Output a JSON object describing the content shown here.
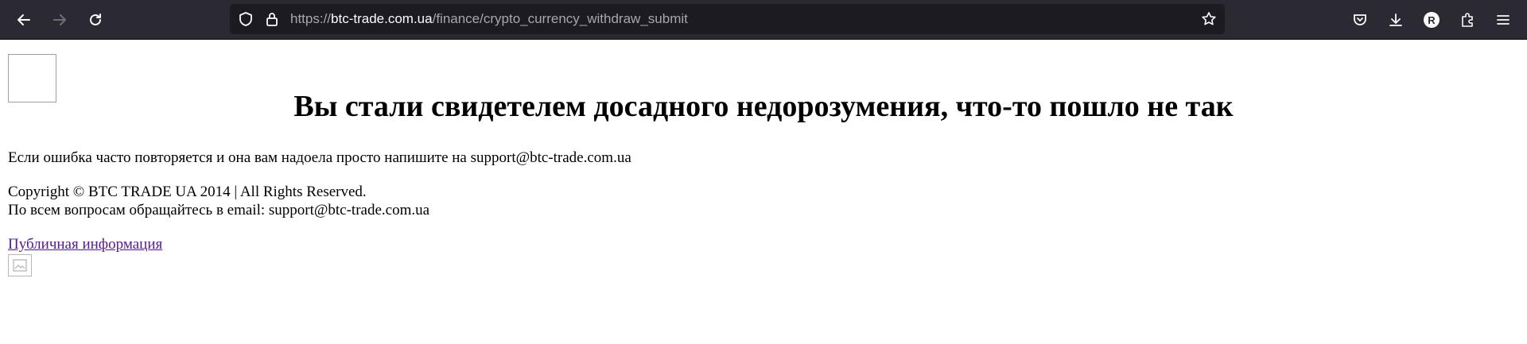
{
  "browser": {
    "url_host_prefix": "https://",
    "url_host": "btc-trade.com.ua",
    "url_path": "/finance/crypto_currency_withdraw_submit",
    "profile_initial": "R"
  },
  "page": {
    "heading": "Вы стали свидетелем досадного недорозумения, что-то пошло не так",
    "error_note": "Если ошибка часто повторяется и она вам надоела просто напишите на support@btc-trade.com.ua",
    "copyright": "Copyright © BTC TRADE UA 2014 | All Rights Reserved.",
    "contact": "По всем вопросам обращайтесь в email: support@btc-trade.com.ua",
    "public_info_link": "Публичная информация"
  }
}
